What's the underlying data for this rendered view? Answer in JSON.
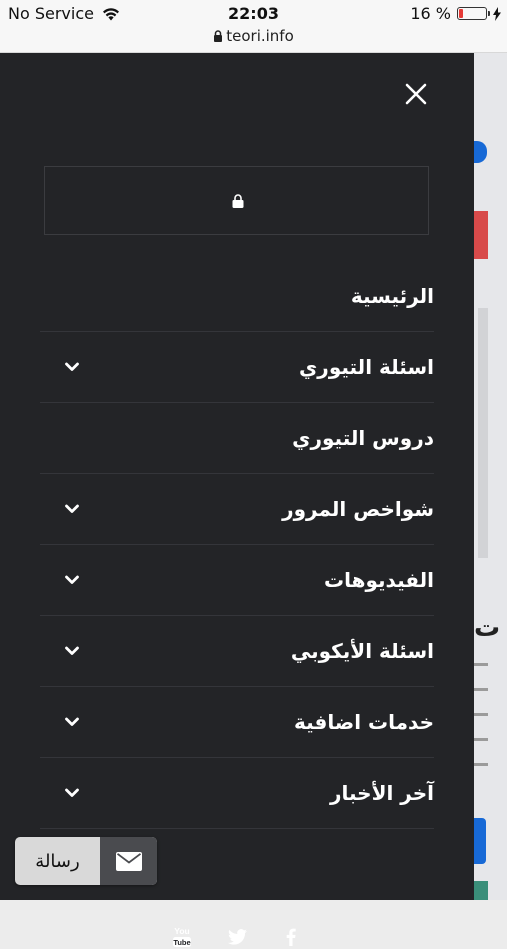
{
  "status_bar": {
    "carrier": "No Service",
    "time": "22:03",
    "battery_percent": "16 %",
    "battery_level": 0.16,
    "url": "teori.info"
  },
  "drawer": {
    "search": {
      "value": "",
      "placeholder": ""
    },
    "menu": [
      {
        "label": "الرئيسية",
        "has_submenu": false
      },
      {
        "label": "اسئلة التيوري",
        "has_submenu": true
      },
      {
        "label": "دروس التيوري",
        "has_submenu": false
      },
      {
        "label": "شواخص المرور",
        "has_submenu": true
      },
      {
        "label": "الفيديوهات",
        "has_submenu": true
      },
      {
        "label": "اسئلة الأيكوبي",
        "has_submenu": true
      },
      {
        "label": "خدمات اضافية",
        "has_submenu": true
      },
      {
        "label": "آخر الأخبار",
        "has_submenu": true
      }
    ],
    "social_icons": [
      "youtube-icon",
      "twitter-icon",
      "facebook-icon"
    ],
    "youtube_text": {
      "top": "You",
      "bottom": "Tube"
    }
  },
  "message_button": {
    "label": "رسالة",
    "icon": "envelope-icon"
  },
  "background_page": {
    "visible_heading_fragment": "ت"
  },
  "colors": {
    "drawer_bg": "#232427",
    "battery_low": "#e53935",
    "accent_blue": "#1769d6"
  }
}
